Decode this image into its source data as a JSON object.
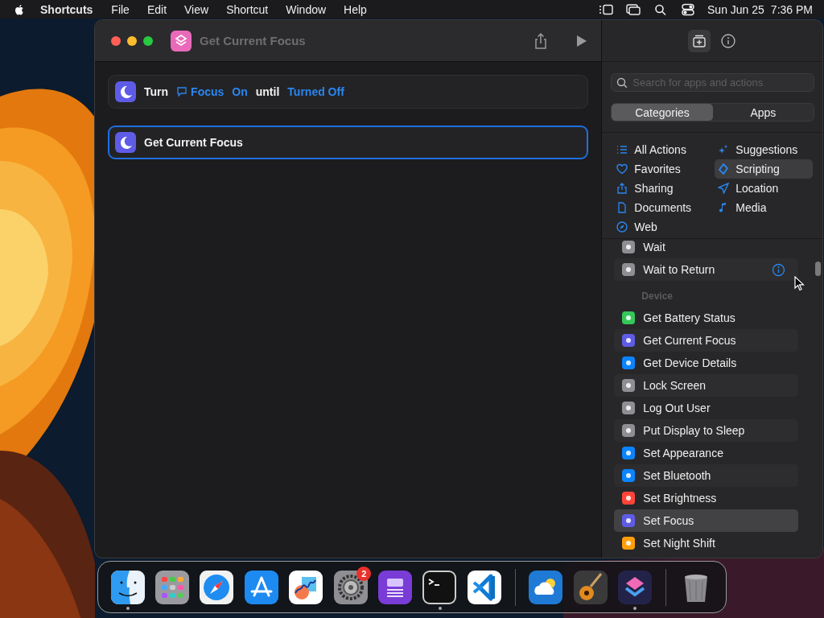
{
  "menu_bar": {
    "app": "Shortcuts",
    "menus": [
      "File",
      "Edit",
      "View",
      "Shortcut",
      "Window",
      "Help"
    ],
    "date": "Sun Jun 25",
    "time": "7:36 PM"
  },
  "window": {
    "title": "Get Current Focus"
  },
  "editor": {
    "actions": [
      {
        "selected": false,
        "tokens": [
          {
            "kind": "plain",
            "text": "Turn"
          },
          {
            "kind": "param",
            "text": "Focus",
            "icon": true
          },
          {
            "kind": "param",
            "text": "On"
          },
          {
            "kind": "plain",
            "text": "until"
          },
          {
            "kind": "param",
            "text": "Turned Off"
          }
        ]
      },
      {
        "selected": true,
        "tokens": [
          {
            "kind": "plain",
            "text": "Get Current Focus"
          }
        ]
      }
    ]
  },
  "sidebar": {
    "search": {
      "placeholder": "Search for apps and actions"
    },
    "segments": [
      {
        "label": "Categories",
        "selected": true
      },
      {
        "label": "Apps",
        "selected": false
      }
    ],
    "categories": [
      {
        "label": "All Actions",
        "selected": false
      },
      {
        "label": "Favorites",
        "selected": false
      },
      {
        "label": "Sharing",
        "selected": false
      },
      {
        "label": "Documents",
        "selected": false
      },
      {
        "label": "Web",
        "selected": false
      },
      {
        "label": "Suggestions",
        "selected": false
      },
      {
        "label": "Scripting",
        "selected": true
      },
      {
        "label": "Location",
        "selected": false
      },
      {
        "label": "Media",
        "selected": false
      }
    ],
    "actions": [
      {
        "kind": "action",
        "label": "Wait",
        "color": "#8e8e93",
        "selected": false
      },
      {
        "kind": "action",
        "label": "Wait to Return",
        "color": "#8e8e93",
        "selected": false,
        "info": true
      },
      {
        "kind": "header",
        "label": "Device"
      },
      {
        "kind": "action",
        "label": "Get Battery Status",
        "color": "#34c759",
        "selected": false
      },
      {
        "kind": "action",
        "label": "Get Current Focus",
        "color": "#5e5ce6",
        "selected": false
      },
      {
        "kind": "action",
        "label": "Get Device Details",
        "color": "#0a84ff",
        "selected": false
      },
      {
        "kind": "action",
        "label": "Lock Screen",
        "color": "#8e8e93",
        "selected": false
      },
      {
        "kind": "action",
        "label": "Log Out User",
        "color": "#8e8e93",
        "selected": false
      },
      {
        "kind": "action",
        "label": "Put Display to Sleep",
        "color": "#8e8e93",
        "selected": false
      },
      {
        "kind": "action",
        "label": "Set Appearance",
        "color": "#0a84ff",
        "selected": false
      },
      {
        "kind": "action",
        "label": "Set Bluetooth",
        "color": "#0a84ff",
        "selected": false
      },
      {
        "kind": "action",
        "label": "Set Brightness",
        "color": "#ff453a",
        "selected": false
      },
      {
        "kind": "action",
        "label": "Set Focus",
        "color": "#5e5ce6",
        "selected": true
      },
      {
        "kind": "action",
        "label": "Set Night Shift",
        "color": "#ff9f0a",
        "selected": false
      }
    ]
  },
  "dock": {
    "items": [
      {
        "kind": "app",
        "running": true
      },
      {
        "kind": "app",
        "running": false
      },
      {
        "kind": "app",
        "running": false
      },
      {
        "kind": "app",
        "running": false
      },
      {
        "kind": "app",
        "running": false
      },
      {
        "kind": "app",
        "running": false,
        "badge": "2"
      },
      {
        "kind": "app",
        "running": false
      },
      {
        "kind": "app",
        "running": true
      },
      {
        "kind": "app",
        "running": false
      },
      {
        "kind": "separator"
      },
      {
        "kind": "app",
        "running": false
      },
      {
        "kind": "app",
        "running": false
      },
      {
        "kind": "app",
        "running": true
      },
      {
        "kind": "separator"
      },
      {
        "kind": "trash",
        "running": false
      }
    ]
  }
}
